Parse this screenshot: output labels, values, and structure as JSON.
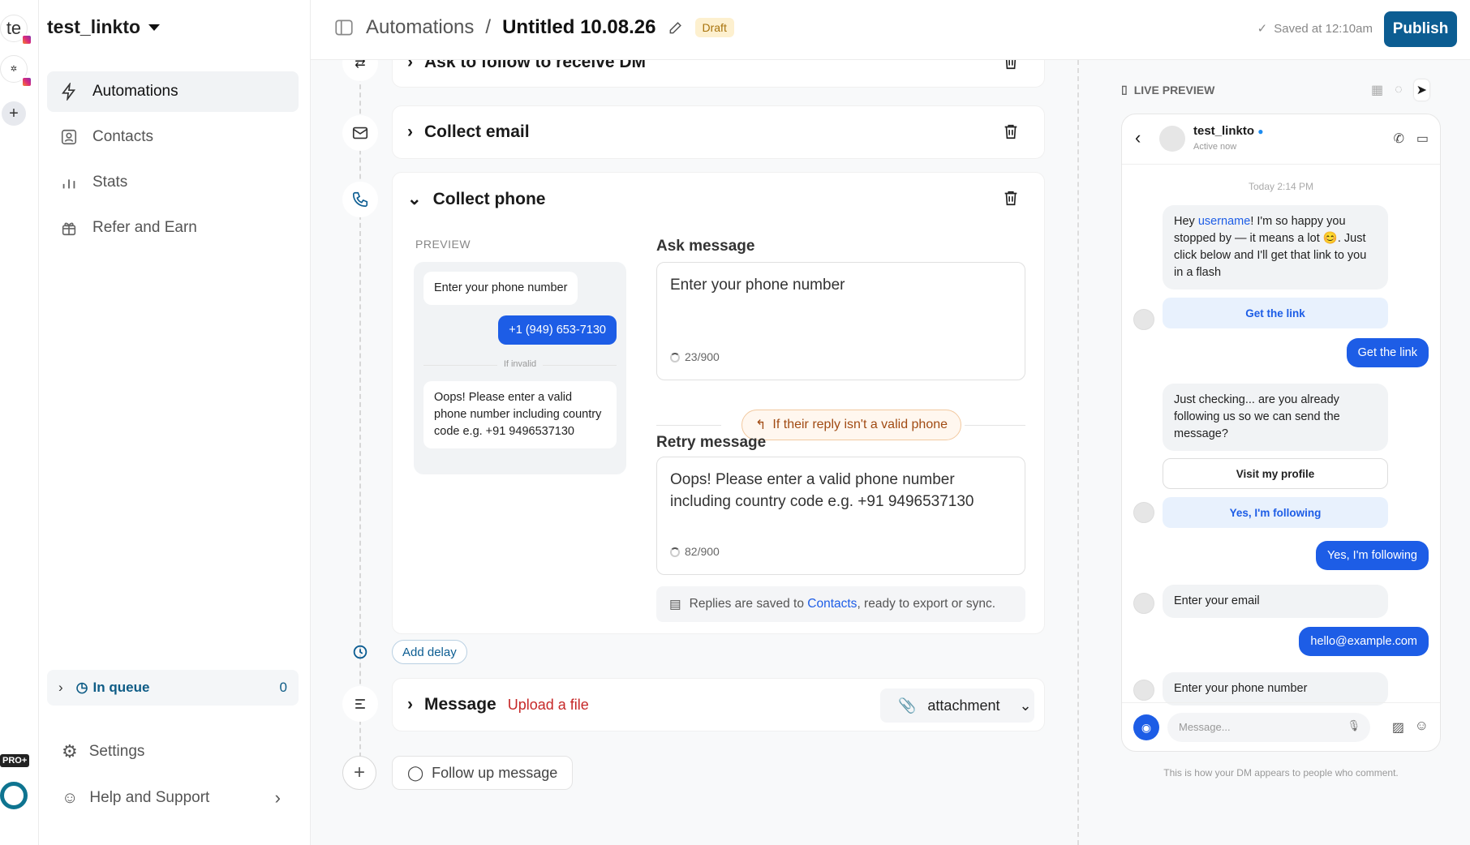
{
  "rail": {
    "account_initials": "te",
    "add": "+",
    "pro_badge": "PRO+"
  },
  "sidebar": {
    "account_name": "test_linkto",
    "nav": [
      {
        "label": "Automations"
      },
      {
        "label": "Contacts"
      },
      {
        "label": "Stats"
      },
      {
        "label": "Refer and Earn"
      }
    ],
    "queue": {
      "label": "In queue",
      "count": "0"
    },
    "settings": "Settings",
    "help": "Help and Support"
  },
  "topbar": {
    "section": "Automations",
    "separator": "/",
    "title": "Untitled 10.08.26",
    "status": "Draft",
    "saved": "Saved at 12:10am",
    "publish": "Publish"
  },
  "steps": {
    "ask_follow": "Ask to follow to receive DM",
    "collect_email": "Collect email",
    "collect_phone": {
      "title": "Collect phone",
      "preview_label": "PREVIEW",
      "preview_prompt": "Enter your phone number",
      "preview_reply": "+1 (949) 653-7130",
      "preview_divider": "If invalid",
      "preview_retry": "Oops! Please enter a valid phone number including country code e.g. +91 9496537130",
      "ask_title": "Ask message",
      "ask_text": "Enter your phone number",
      "ask_count": "23/900",
      "invalid_label": "If their reply isn't a valid phone",
      "retry_title": "Retry message",
      "retry_text": "Oops! Please enter a valid phone number including country code e.g. +91 9496537130",
      "retry_count": "82/900",
      "note_prefix": "Replies are saved to ",
      "note_link": "Contacts",
      "note_suffix": ", ready to export or sync."
    },
    "add_delay": "Add delay",
    "message": {
      "title": "Message",
      "upload": "Upload a file",
      "type": "attachment"
    },
    "follow_up": "Follow up message"
  },
  "preview": {
    "header": "LIVE PREVIEW",
    "profile_name": "test_linkto",
    "profile_status": "Active now",
    "timestamp": "Today 2:14 PM",
    "msg1_pre": "Hey ",
    "msg1_link": "username",
    "msg1_post": "! I'm so happy you stopped by — it means a lot 😊. Just click below and I'll get that link to you in a flash",
    "btn_get_link": "Get the link",
    "reply_get_link": "Get the link",
    "msg2": "Just checking... are you already following us so we can send the message?",
    "btn_visit": "Visit my profile",
    "btn_following": "Yes, I'm following",
    "reply_following": "Yes, I'm following",
    "msg3": "Enter your email",
    "reply_email": "hello@example.com",
    "msg4": "Enter your phone number",
    "input_placeholder": "Message...",
    "caption": "This is how your DM appears to people who comment."
  }
}
